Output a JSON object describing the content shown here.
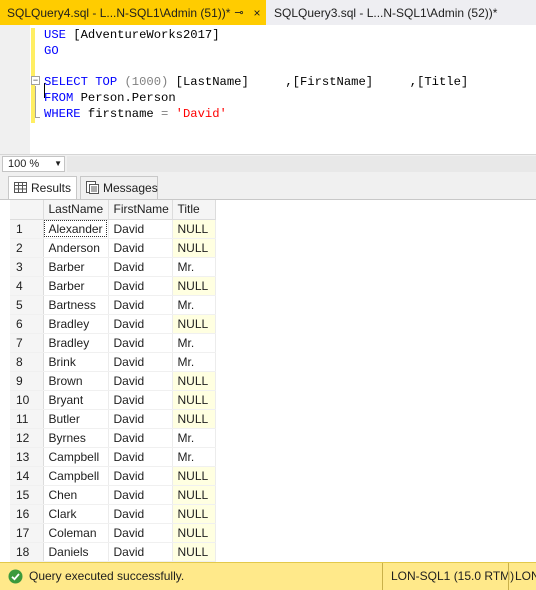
{
  "tabs": {
    "active": {
      "title": "SQLQuery4.sql - L...N-SQL1\\Admin (51))*",
      "pin": "⊸",
      "close": "×"
    },
    "inactive": {
      "title": "SQLQuery3.sql - L...N-SQL1\\Admin (52))*",
      "close": "×"
    }
  },
  "editor": {
    "lines": [
      {
        "kw": "USE ",
        "rest": "[AdventureWorks2017]"
      },
      {
        "kw": "GO",
        "rest": ""
      },
      {
        "kw": "",
        "rest": ""
      },
      {
        "kw": "SELECT TOP ",
        "paren": "(1000) ",
        "cols": "[LastName]     ,[FirstName]     ,[Title]"
      },
      {
        "kw": "FROM ",
        "rest": "Person.Person"
      },
      {
        "kw": "WHERE ",
        "rest": "firstname ",
        "op": "= ",
        "str": "'David'"
      }
    ],
    "collapse_symbol": "−"
  },
  "zoom": {
    "value": "100 %"
  },
  "result_tabs": {
    "results": "Results",
    "messages": "Messages"
  },
  "grid": {
    "columns": [
      "",
      "LastName",
      "FirstName",
      "Title"
    ],
    "rows": [
      [
        "1",
        "Alexander",
        "David",
        "NULL"
      ],
      [
        "2",
        "Anderson",
        "David",
        "NULL"
      ],
      [
        "3",
        "Barber",
        "David",
        "Mr."
      ],
      [
        "4",
        "Barber",
        "David",
        "NULL"
      ],
      [
        "5",
        "Bartness",
        "David",
        "Mr."
      ],
      [
        "6",
        "Bradley",
        "David",
        "NULL"
      ],
      [
        "7",
        "Bradley",
        "David",
        "Mr."
      ],
      [
        "8",
        "Brink",
        "David",
        "Mr."
      ],
      [
        "9",
        "Brown",
        "David",
        "NULL"
      ],
      [
        "10",
        "Bryant",
        "David",
        "NULL"
      ],
      [
        "11",
        "Butler",
        "David",
        "NULL"
      ],
      [
        "12",
        "Byrnes",
        "David",
        "Mr."
      ],
      [
        "13",
        "Campbell",
        "David",
        "Mr."
      ],
      [
        "14",
        "Campbell",
        "David",
        "NULL"
      ],
      [
        "15",
        "Chen",
        "David",
        "NULL"
      ],
      [
        "16",
        "Clark",
        "David",
        "NULL"
      ],
      [
        "17",
        "Coleman",
        "David",
        "NULL"
      ],
      [
        "18",
        "Daniels",
        "David",
        "NULL"
      ]
    ]
  },
  "status": {
    "message": "Query executed successfully.",
    "server": "LON-SQL1 (15.0 RTM)",
    "server_cut": "LON"
  },
  "colors": {
    "accent": "#ffcc00",
    "status_bg": "#ffe98a",
    "null_bg": "#ffffe1",
    "keyword": "#0000ff",
    "string": "#ff0000",
    "operator": "#808080"
  }
}
